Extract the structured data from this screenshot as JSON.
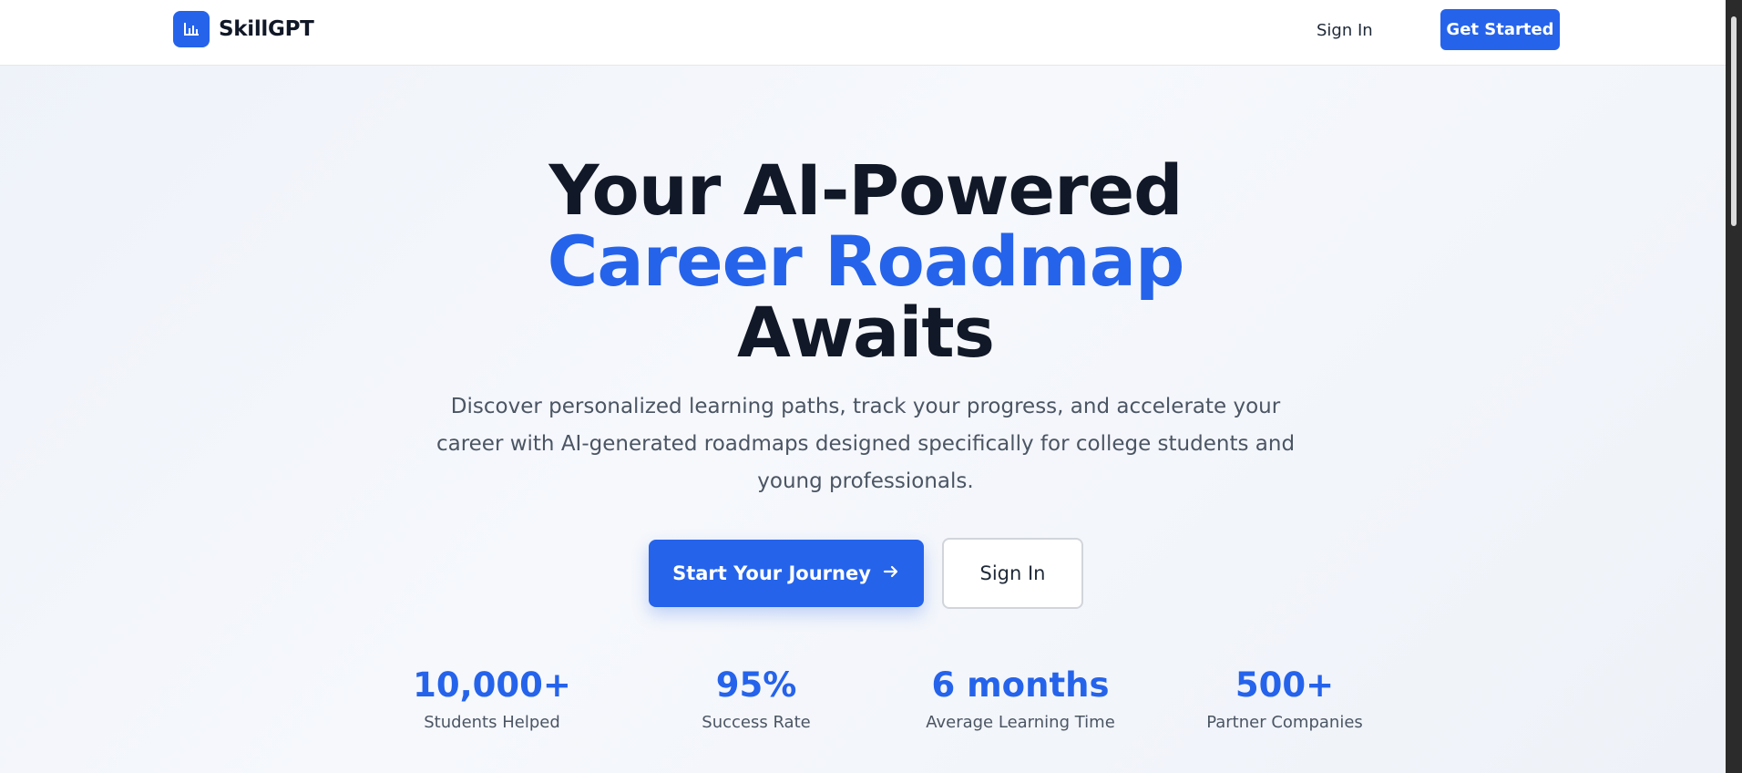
{
  "nav": {
    "brand": "SkillGPT",
    "brand_icon": "bar-chart-icon",
    "sign_in": "Sign In",
    "get_started": "Get Started"
  },
  "hero": {
    "title_line1": "Your AI-Powered",
    "title_accent": "Career Roadmap",
    "title_line3": "Awaits",
    "subtitle": "Discover personalized learning paths, track your progress, and accelerate your career with AI-generated roadmaps designed specifically for college students and young professionals.",
    "cta_primary": "Start Your Journey",
    "cta_primary_icon": "arrow-right-icon",
    "cta_secondary": "Sign In"
  },
  "stats": [
    {
      "value": "10,000+",
      "label": "Students Helped"
    },
    {
      "value": "95%",
      "label": "Success Rate"
    },
    {
      "value": "6 months",
      "label": "Average Learning Time"
    },
    {
      "value": "500+",
      "label": "Partner Companies"
    }
  ],
  "colors": {
    "accent": "#2563eb",
    "heading": "#111827",
    "body_text": "#4b5563"
  }
}
